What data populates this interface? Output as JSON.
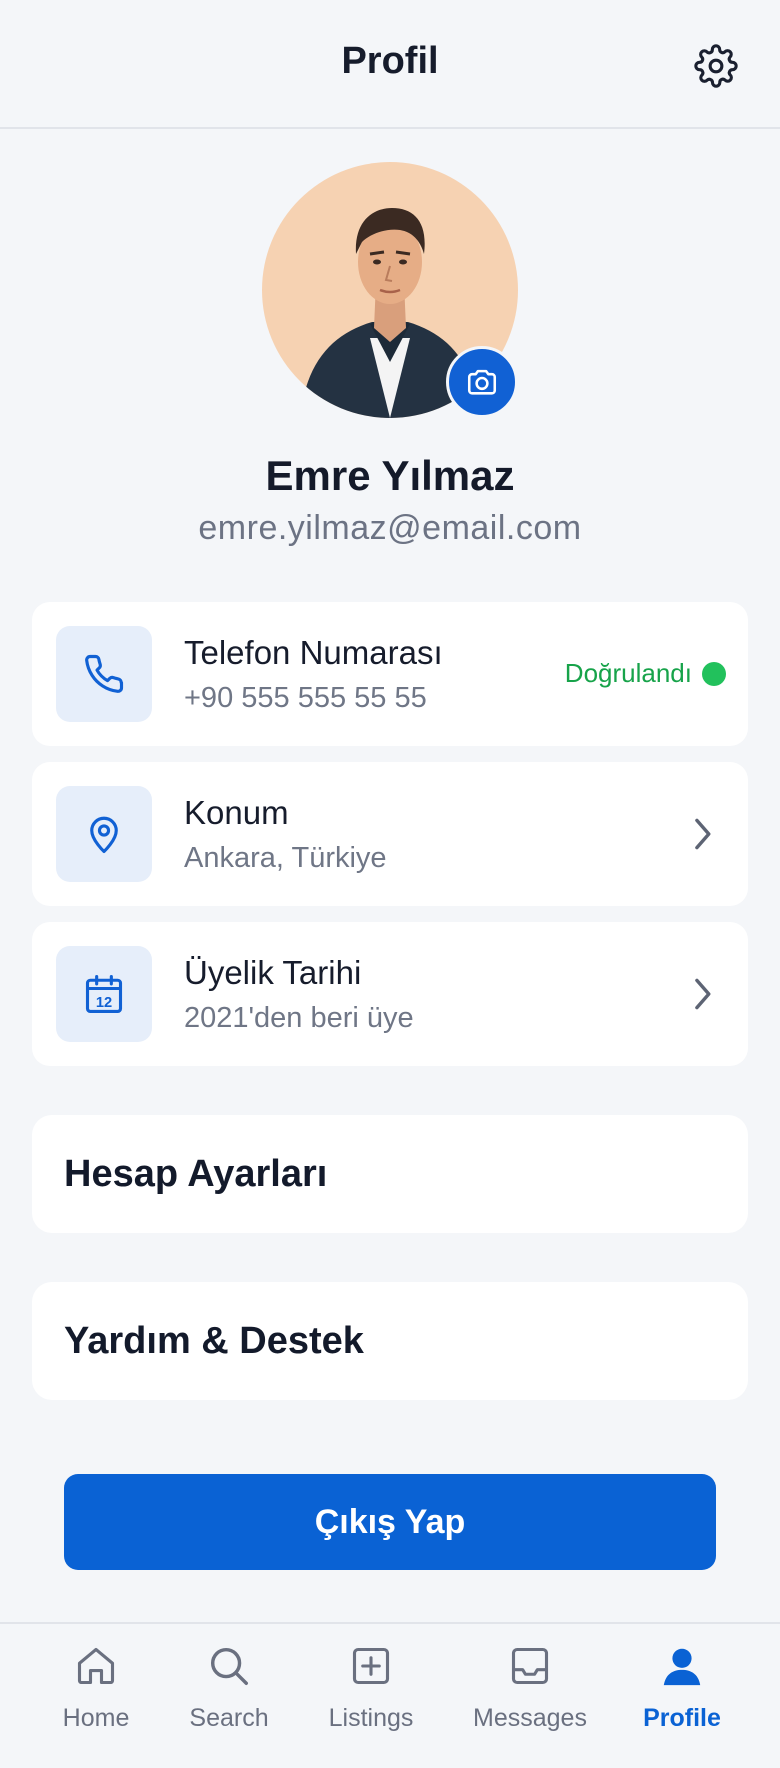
{
  "header": {
    "title": "Profil",
    "settings_icon": "gear-icon"
  },
  "profile": {
    "name": "Emre Yılmaz",
    "email": "emre.yilmaz@email.com",
    "camera_icon": "camera-icon"
  },
  "info_cards": [
    {
      "icon": "phone-icon",
      "title": "Telefon Numarası",
      "subtitle": "+90 555 555 55 55",
      "status": "Doğrulandı"
    },
    {
      "icon": "location-pin-icon",
      "title": "Konum",
      "subtitle": "Ankara, Türkiye"
    },
    {
      "icon": "calendar-icon",
      "title": "Üyelik Tarihi",
      "subtitle": "2021'den beri üye",
      "calendar_day": "12"
    }
  ],
  "sections": [
    {
      "title": "Hesap Ayarları"
    },
    {
      "title": "Yardım & Destek"
    }
  ],
  "logout_label": "Çıkış Yap",
  "bottom_nav": [
    {
      "label": "Home",
      "icon": "home-icon"
    },
    {
      "label": "Search",
      "icon": "search-icon"
    },
    {
      "label": "Listings",
      "icon": "add-listing-icon"
    },
    {
      "label": "Messages",
      "icon": "inbox-icon"
    },
    {
      "label": "Profile",
      "icon": "user-icon",
      "active": true
    }
  ],
  "colors": {
    "primary": "#0a62d4",
    "verified": "#17a34a",
    "background": "#f4f6f9"
  }
}
